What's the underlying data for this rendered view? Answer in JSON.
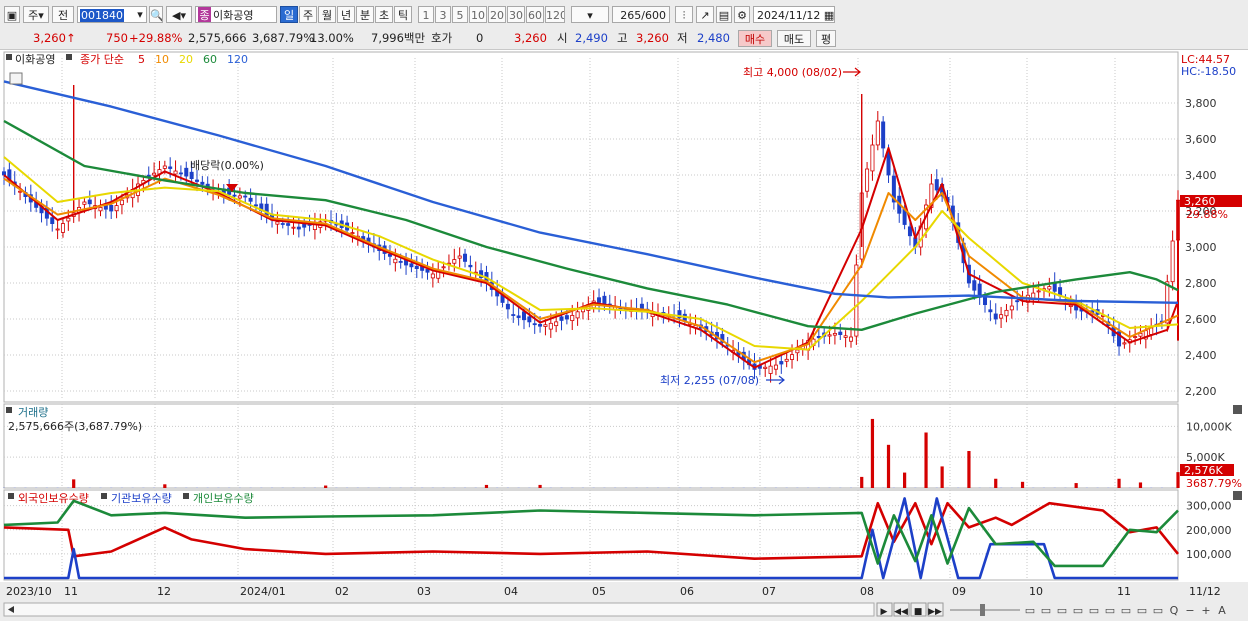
{
  "toolbar": {
    "period_unit": "주",
    "market": "전",
    "code": "001840",
    "stock_name": "이화공영",
    "stock_badge": "종",
    "periods": [
      "일",
      "주",
      "월",
      "년",
      "분",
      "초",
      "틱"
    ],
    "active_period": "일",
    "intervals": [
      "1",
      "3",
      "5",
      "10",
      "20",
      "30",
      "60",
      "120"
    ],
    "count": "265",
    "count_max": "/600",
    "date": "2024/11/12"
  },
  "quote": {
    "price": "3,260",
    "arrow": "↑",
    "change": "750",
    "change_pct": "+29.88%",
    "volume": "2,575,666",
    "volume_ratio": "3,687.79%",
    "turnover": "13.00%",
    "amount": "7,996백만",
    "quote_label": "호가",
    "quote_value": "0",
    "ask": "3,260",
    "open_label": "시",
    "open": "2,490",
    "high_label": "고",
    "high": "3,260",
    "low_label": "저",
    "low": "2,480",
    "buy_label": "매수",
    "sell_label": "매도",
    "eval_label": "평"
  },
  "legend": {
    "stock_name": "이화공영",
    "prefix": "종가 단순",
    "ma": [
      {
        "label": "5",
        "color": "#d40000"
      },
      {
        "label": "10",
        "color": "#f08a00"
      },
      {
        "label": "20",
        "color": "#e8d800"
      },
      {
        "label": "60",
        "color": "#1c8a3a"
      },
      {
        "label": "120",
        "color": "#2a5fd6"
      }
    ],
    "lc": "LC:44.57",
    "hc": "HC:-18.50"
  },
  "annotations": {
    "high": "최고 4,000 (08/02)",
    "low": "최저 2,255 (07/08)",
    "dividend": "배당락(0.00%)",
    "last_price": "3,260",
    "last_pct": "29.88%"
  },
  "volume_panel": {
    "title": "거래량",
    "current": "2,575,666주(3,687.79%)",
    "ticks": [
      "10,000K",
      "5,000K"
    ],
    "last": "2,576K",
    "last_pct": "3687.79%"
  },
  "holding_panel": {
    "series": [
      {
        "name": "외국인보유수량",
        "color": "#d40000"
      },
      {
        "name": "기관보유수량",
        "color": "#1d40c8"
      },
      {
        "name": "개인보유수량",
        "color": "#1c8a3a"
      }
    ],
    "ticks": [
      "300,000",
      "200,000",
      "100,000"
    ]
  },
  "chart_data": {
    "type": "line",
    "title": "이화공영",
    "price_axis": {
      "ylim": [
        2150,
        4050
      ],
      "ticks": [
        2200,
        2400,
        2600,
        2800,
        3000,
        3200,
        3400,
        3600,
        3800
      ]
    },
    "x_labels": [
      "2023/10",
      "11",
      "12",
      "2024/01",
      "02",
      "03",
      "04",
      "05",
      "06",
      "07",
      "08",
      "09",
      "10",
      "11",
      "11/12"
    ],
    "close": [
      [
        0,
        3400
      ],
      [
        5,
        3250
      ],
      [
        10,
        3100
      ],
      [
        15,
        3250
      ],
      [
        20,
        3200
      ],
      [
        25,
        3350
      ],
      [
        30,
        3450
      ],
      [
        35,
        3380
      ],
      [
        40,
        3300
      ],
      [
        45,
        3280
      ],
      [
        50,
        3150
      ],
      [
        55,
        3100
      ],
      [
        60,
        3150
      ],
      [
        65,
        3080
      ],
      [
        70,
        2980
      ],
      [
        75,
        2900
      ],
      [
        80,
        2850
      ],
      [
        85,
        2950
      ],
      [
        90,
        2800
      ],
      [
        95,
        2620
      ],
      [
        100,
        2560
      ],
      [
        105,
        2600
      ],
      [
        110,
        2700
      ],
      [
        115,
        2660
      ],
      [
        120,
        2640
      ],
      [
        125,
        2620
      ],
      [
        130,
        2550
      ],
      [
        135,
        2450
      ],
      [
        140,
        2320
      ],
      [
        145,
        2350
      ],
      [
        150,
        2480
      ],
      [
        155,
        2520
      ],
      [
        158,
        2500
      ],
      [
        160,
        3300
      ],
      [
        163,
        3700
      ],
      [
        166,
        3250
      ],
      [
        170,
        3000
      ],
      [
        173,
        3350
      ],
      [
        176,
        3250
      ],
      [
        180,
        2800
      ],
      [
        185,
        2600
      ],
      [
        190,
        2720
      ],
      [
        195,
        2780
      ],
      [
        200,
        2650
      ],
      [
        205,
        2620
      ],
      [
        208,
        2450
      ],
      [
        212,
        2520
      ],
      [
        216,
        2580
      ],
      [
        219,
        3260
      ]
    ],
    "series": [
      {
        "name": "5",
        "values": [
          [
            0,
            3400
          ],
          [
            10,
            3150
          ],
          [
            20,
            3250
          ],
          [
            30,
            3420
          ],
          [
            40,
            3300
          ],
          [
            50,
            3150
          ],
          [
            60,
            3120
          ],
          [
            70,
            2990
          ],
          [
            80,
            2870
          ],
          [
            90,
            2800
          ],
          [
            100,
            2580
          ],
          [
            110,
            2690
          ],
          [
            120,
            2640
          ],
          [
            130,
            2540
          ],
          [
            140,
            2330
          ],
          [
            150,
            2470
          ],
          [
            160,
            3100
          ],
          [
            165,
            3550
          ],
          [
            170,
            3050
          ],
          [
            175,
            3350
          ],
          [
            180,
            2850
          ],
          [
            190,
            2700
          ],
          [
            200,
            2680
          ],
          [
            210,
            2470
          ],
          [
            217,
            2540
          ],
          [
            219,
            2700
          ]
        ]
      },
      {
        "name": "10",
        "values": [
          [
            0,
            3380
          ],
          [
            10,
            3180
          ],
          [
            20,
            3240
          ],
          [
            30,
            3380
          ],
          [
            40,
            3290
          ],
          [
            50,
            3160
          ],
          [
            60,
            3130
          ],
          [
            70,
            3000
          ],
          [
            80,
            2880
          ],
          [
            90,
            2810
          ],
          [
            100,
            2600
          ],
          [
            110,
            2680
          ],
          [
            120,
            2650
          ],
          [
            130,
            2560
          ],
          [
            140,
            2360
          ],
          [
            150,
            2460
          ],
          [
            160,
            2900
          ],
          [
            165,
            3300
          ],
          [
            170,
            3150
          ],
          [
            175,
            3300
          ],
          [
            180,
            2950
          ],
          [
            190,
            2720
          ],
          [
            200,
            2690
          ],
          [
            210,
            2500
          ],
          [
            219,
            2620
          ]
        ]
      },
      {
        "name": "20",
        "values": [
          [
            0,
            3500
          ],
          [
            10,
            3250
          ],
          [
            20,
            3300
          ],
          [
            30,
            3330
          ],
          [
            40,
            3310
          ],
          [
            50,
            3180
          ],
          [
            60,
            3150
          ],
          [
            70,
            3060
          ],
          [
            80,
            2930
          ],
          [
            90,
            2830
          ],
          [
            100,
            2650
          ],
          [
            110,
            2660
          ],
          [
            120,
            2640
          ],
          [
            130,
            2600
          ],
          [
            140,
            2450
          ],
          [
            150,
            2430
          ],
          [
            160,
            2700
          ],
          [
            170,
            3000
          ],
          [
            175,
            3200
          ],
          [
            180,
            3050
          ],
          [
            190,
            2800
          ],
          [
            200,
            2700
          ],
          [
            210,
            2550
          ],
          [
            219,
            2570
          ]
        ]
      },
      {
        "name": "60",
        "values": [
          [
            0,
            3700
          ],
          [
            15,
            3450
          ],
          [
            30,
            3370
          ],
          [
            45,
            3300
          ],
          [
            60,
            3260
          ],
          [
            75,
            3150
          ],
          [
            90,
            3000
          ],
          [
            105,
            2880
          ],
          [
            120,
            2770
          ],
          [
            135,
            2680
          ],
          [
            150,
            2560
          ],
          [
            160,
            2540
          ],
          [
            170,
            2630
          ],
          [
            185,
            2750
          ],
          [
            200,
            2820
          ],
          [
            210,
            2860
          ],
          [
            215,
            2820
          ],
          [
            219,
            2760
          ]
        ]
      },
      {
        "name": "120",
        "values": [
          [
            0,
            3920
          ],
          [
            20,
            3780
          ],
          [
            40,
            3620
          ],
          [
            60,
            3450
          ],
          [
            80,
            3250
          ],
          [
            100,
            3080
          ],
          [
            120,
            2960
          ],
          [
            140,
            2830
          ],
          [
            155,
            2740
          ],
          [
            165,
            2720
          ],
          [
            180,
            2730
          ],
          [
            200,
            2700
          ],
          [
            219,
            2690
          ]
        ]
      }
    ],
    "volume_series": [
      [
        13,
        1400
      ],
      [
        30,
        600
      ],
      [
        60,
        400
      ],
      [
        90,
        500
      ],
      [
        100,
        500
      ],
      [
        160,
        1800
      ],
      [
        162,
        11200
      ],
      [
        165,
        7000
      ],
      [
        168,
        2500
      ],
      [
        172,
        9000
      ],
      [
        175,
        3500
      ],
      [
        180,
        6000
      ],
      [
        185,
        1500
      ],
      [
        190,
        1000
      ],
      [
        200,
        800
      ],
      [
        208,
        1500
      ],
      [
        212,
        900
      ],
      [
        219,
        2576
      ]
    ],
    "holding_series": [
      {
        "name": "외국인보유수량",
        "values": [
          [
            0,
            210000
          ],
          [
            12,
            200000
          ],
          [
            13,
            90000
          ],
          [
            20,
            110000
          ],
          [
            30,
            210000
          ],
          [
            35,
            160000
          ],
          [
            45,
            120000
          ],
          [
            60,
            100000
          ],
          [
            80,
            110000
          ],
          [
            100,
            100000
          ],
          [
            120,
            110000
          ],
          [
            140,
            80000
          ],
          [
            160,
            90000
          ],
          [
            163,
            310000
          ],
          [
            166,
            150000
          ],
          [
            170,
            310000
          ],
          [
            173,
            140000
          ],
          [
            176,
            310000
          ],
          [
            180,
            210000
          ],
          [
            185,
            250000
          ],
          [
            188,
            220000
          ],
          [
            195,
            310000
          ],
          [
            205,
            280000
          ],
          [
            210,
            190000
          ],
          [
            215,
            210000
          ],
          [
            219,
            100000
          ]
        ]
      },
      {
        "name": "기관보유수량",
        "values": [
          [
            0,
            0
          ],
          [
            12,
            0
          ],
          [
            13,
            120000
          ],
          [
            14,
            0
          ],
          [
            160,
            0
          ],
          [
            162,
            200000
          ],
          [
            164,
            0
          ],
          [
            168,
            330000
          ],
          [
            171,
            0
          ],
          [
            174,
            330000
          ],
          [
            178,
            0
          ],
          [
            182,
            0
          ],
          [
            184,
            140000
          ],
          [
            194,
            140000
          ],
          [
            196,
            0
          ],
          [
            219,
            0
          ]
        ]
      },
      {
        "name": "개인보유수량",
        "values": [
          [
            0,
            220000
          ],
          [
            10,
            230000
          ],
          [
            13,
            320000
          ],
          [
            20,
            260000
          ],
          [
            30,
            270000
          ],
          [
            45,
            250000
          ],
          [
            60,
            255000
          ],
          [
            80,
            260000
          ],
          [
            100,
            280000
          ],
          [
            120,
            270000
          ],
          [
            140,
            260000
          ],
          [
            160,
            270000
          ],
          [
            163,
            60000
          ],
          [
            166,
            260000
          ],
          [
            170,
            70000
          ],
          [
            173,
            260000
          ],
          [
            176,
            60000
          ],
          [
            180,
            290000
          ],
          [
            185,
            140000
          ],
          [
            192,
            150000
          ],
          [
            196,
            50000
          ],
          [
            205,
            50000
          ],
          [
            210,
            200000
          ],
          [
            215,
            190000
          ],
          [
            219,
            280000
          ]
        ]
      }
    ]
  }
}
